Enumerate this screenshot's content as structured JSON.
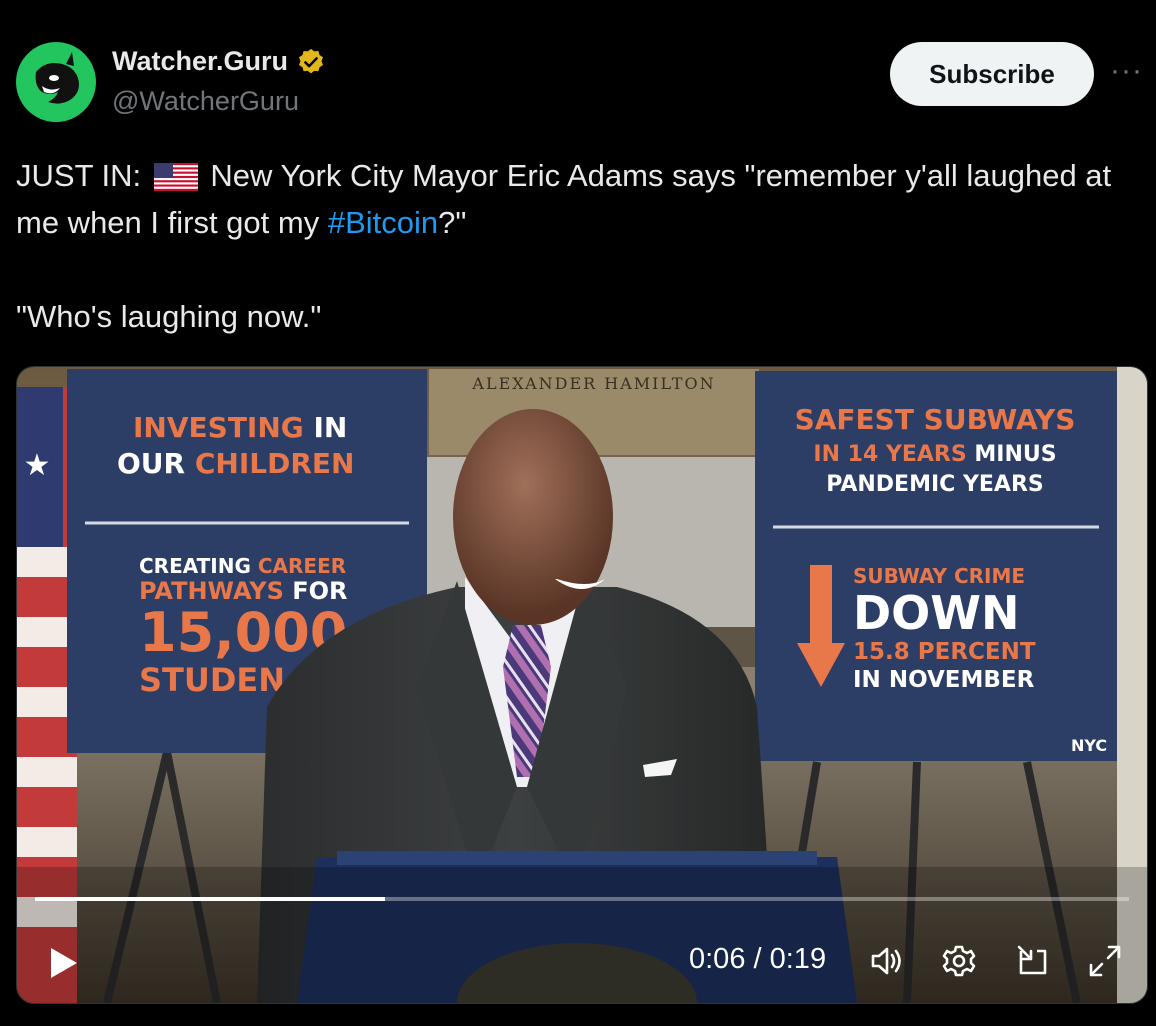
{
  "author": {
    "display_name": "Watcher.Guru",
    "handle": "@WatcherGuru",
    "verified_badge_icon": "verified-gold-badge-icon",
    "avatar_icon": "orca-logo-icon",
    "avatar_color": "#22c55e"
  },
  "actions": {
    "subscribe_label": "Subscribe",
    "more_label": "···"
  },
  "tweet": {
    "prefix": "JUST IN: ",
    "flag_icon": "us-flag-icon",
    "line1_rest": " New York City Mayor Eric Adams says \"remember y'all laughed at me when I first got my ",
    "hashtag": "#Bitcoin",
    "line1_end": "?\"",
    "line2": "\"Who's laughing now.\"",
    "hashtag_color": "#1d9bf0"
  },
  "video": {
    "left_sign": {
      "line1a": "INVESTING",
      "line1b": " IN",
      "line2a": "OUR",
      "line2b": " CHILDREN",
      "line3a": "CREATING",
      "line3b": " CAREER",
      "line4a": "PATHWAYS",
      "line4b": " FOR",
      "line5": "15,000",
      "line6": "STUDEN"
    },
    "right_sign": {
      "line1": "SAFEST SUBWAYS",
      "line2a": "IN 14 YEARS",
      "line2b": " MINUS",
      "line3": "PANDEMIC YEARS",
      "line4": "SUBWAY CRIME",
      "line5": "DOWN",
      "line6": "15.8 PERCENT",
      "line7": "IN NOVEMBER",
      "logo": "NYC"
    },
    "plaque": "ALEXANDER HAMILTON",
    "accent_orange": "#e8774a",
    "sign_blue": "#2c3e66",
    "progress_fraction": 0.32,
    "time_current": "0:06",
    "time_separator": " / ",
    "time_total": "0:19",
    "icons": [
      "play-icon",
      "volume-icon",
      "settings-gear-icon",
      "picture-in-picture-icon",
      "fullscreen-icon"
    ]
  }
}
